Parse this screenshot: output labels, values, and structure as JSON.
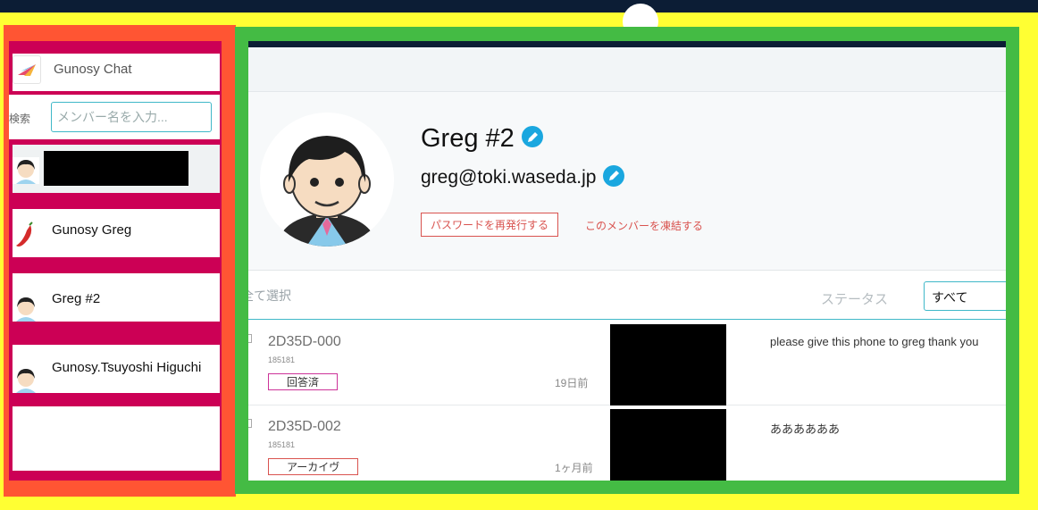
{
  "sidebar": {
    "app_title": "Gunosy Chat",
    "search_label": "検索",
    "search_placeholder": "メンバー名を入力...",
    "members": [
      {
        "name": "",
        "redacted": true
      },
      {
        "name": "Gunosy Greg"
      },
      {
        "name": "Greg #2"
      },
      {
        "name": "Gunosy.Tsuyoshi Higuchi"
      }
    ]
  },
  "profile": {
    "name": "Greg #2",
    "email": "greg@toki.waseda.jp",
    "reset_password_label": "パスワードを再発行する",
    "freeze_label": "このメンバーを凍結する"
  },
  "filter": {
    "select_all_label": "全て選択",
    "status_label": "ステータス",
    "status_value": "すべて"
  },
  "messages": [
    {
      "id": "2D35D-000",
      "number": "185181",
      "badge": "回答済",
      "time": "19日前",
      "text": "please give this phone to greg thank you"
    },
    {
      "id": "2D35D-002",
      "number": "185181",
      "badge": "アーカイヴ",
      "time": "1ヶ月前",
      "text": "ああああああ"
    }
  ],
  "colors": {
    "accent": "#1aa7df",
    "border_teal": "#3fb8c8",
    "danger": "#d9534f",
    "annotation_yellow": "#ffff33",
    "annotation_red": "#ff5533",
    "annotation_pink": "#cc0055",
    "annotation_green": "#44bb44"
  },
  "icons": {
    "app_logo": "paper-plane-icon",
    "edit": "pencil-icon",
    "avatar": "person-avatar-icon"
  }
}
